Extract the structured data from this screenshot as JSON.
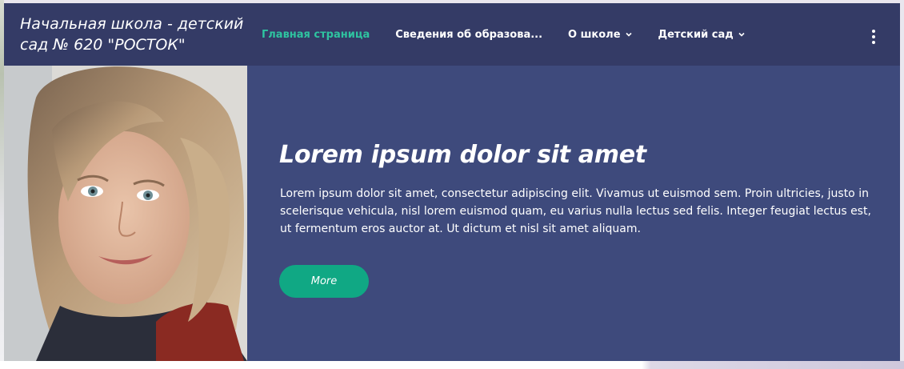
{
  "header": {
    "brand_line1": "Начальная школа - детский",
    "brand_line2": "сад № 620 \"РОСТОК\"",
    "nav": [
      {
        "label": "Главная страница",
        "active": true
      },
      {
        "label": "Сведения об образова...",
        "active": false
      },
      {
        "label": "О школе",
        "active": false,
        "dropdown": true
      },
      {
        "label": "Детский сад",
        "active": false,
        "dropdown": true
      }
    ],
    "menu_icon": "kebab-menu-icon"
  },
  "hero": {
    "image": "portrait-photo",
    "title": "Lorem ipsum dolor sit amet",
    "text": "Lorem ipsum dolor sit amet, consectetur adipiscing elit. Vivamus ut euismod sem. Proin ultricies, justo in scelerisque vehicula, nisl lorem euismod quam, eu varius nulla lectus sed felis. Integer feugiat lectus est, ut fermentum eros auctor at. Ut dictum et nisl sit amet aliquam.",
    "button_label": "More"
  },
  "colors": {
    "header_bg": "#343b66",
    "hero_bg": "#3e4a7c",
    "accent": "#2ec4a0",
    "button": "#10a884"
  }
}
